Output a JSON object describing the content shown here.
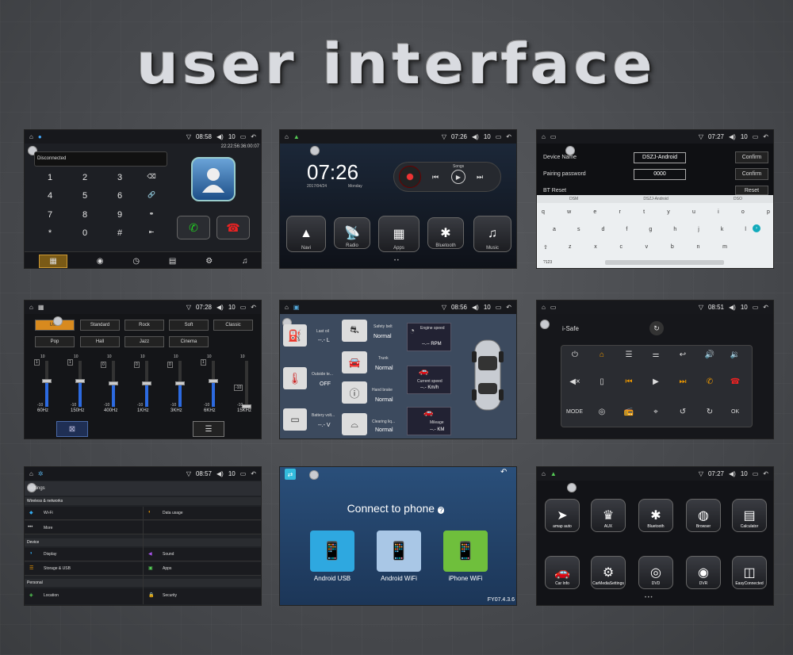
{
  "title": "user interface",
  "s1": {
    "time": "08:58",
    "vol": "10",
    "datetime": "22:22:56:36:00:07",
    "status": "Disconnected",
    "keys": [
      "1",
      "2",
      "3",
      "⌫",
      "4",
      "5",
      "6",
      "🔗",
      "7",
      "8",
      "9",
      "⚭",
      "*",
      "0",
      "#",
      "⇤"
    ]
  },
  "s2": {
    "time": "07:26",
    "vol": "10",
    "clock": "07:26",
    "date": "2017/04/24",
    "day": "Monday",
    "songs": "Songs",
    "apps": [
      {
        "label": "Navi",
        "icon": "▲"
      },
      {
        "label": "Radio",
        "icon": "📡"
      },
      {
        "label": "Apps",
        "icon": "▦"
      },
      {
        "label": "Bluetooth",
        "icon": "✱"
      },
      {
        "label": "Music",
        "icon": "♫"
      }
    ]
  },
  "s3": {
    "time": "07:27",
    "vol": "10",
    "device_name_label": "Device Name",
    "device_name": "DSZJ-Android",
    "pairing_label": "Pairing password",
    "pairing": "0000",
    "reset_label": "BT Reset",
    "confirm": "Confirm",
    "reset": "Reset",
    "suggest": [
      "DSM",
      "DSZJ-Android",
      "DSO"
    ],
    "kb_row1": [
      "q",
      "w",
      "e",
      "r",
      "t",
      "y",
      "u",
      "i",
      "o",
      "p"
    ],
    "kb_row2": [
      "a",
      "s",
      "d",
      "f",
      "g",
      "h",
      "j",
      "k",
      "l"
    ],
    "kb_row3": [
      "z",
      "x",
      "c",
      "v",
      "b",
      "n",
      "m"
    ],
    "kb_sym": "?123"
  },
  "s4": {
    "time": "07:28",
    "vol": "10",
    "presets": [
      "User",
      "Standard",
      "Rock",
      "Soft",
      "Classic",
      "Pop",
      "Hall",
      "Jazz",
      "Cinema"
    ],
    "scale_top": "10",
    "scale_bot": "-10",
    "bands": [
      {
        "freq": "60Hz",
        "val": "1"
      },
      {
        "freq": "150Hz",
        "val": "1"
      },
      {
        "freq": "400Hz",
        "val": "0"
      },
      {
        "freq": "1KHz",
        "val": "0"
      },
      {
        "freq": "3KHz",
        "val": "0"
      },
      {
        "freq": "6KHz",
        "val": "1"
      },
      {
        "freq": "15KHz",
        "val": "-10"
      }
    ],
    "levels": [
      0.55,
      0.55,
      0.5,
      0.5,
      0.5,
      0.55,
      0.0
    ]
  },
  "s5": {
    "time": "08:56",
    "vol": "10",
    "items": [
      {
        "label": "Last oil",
        "value": "--.- L"
      },
      {
        "label": "Outside te...",
        "value": "OFF"
      },
      {
        "label": "Battery volt...",
        "value": "--.- V"
      }
    ],
    "items2": [
      {
        "label": "Safety belt",
        "value": "Normal"
      },
      {
        "label": "Trunk",
        "value": "Normal"
      },
      {
        "label": "Hand brake",
        "value": "Normal"
      },
      {
        "label": "Clearing liq...",
        "value": "Normal"
      }
    ],
    "gauges": [
      {
        "label": "Engine speed",
        "value": "--.-- RPM"
      },
      {
        "label": "Current speed",
        "value": "--.- Km/h"
      },
      {
        "label": "Mileage",
        "value": "--.- KM"
      }
    ]
  },
  "s6": {
    "time": "08:51",
    "vol": "10",
    "title": "i-Safe",
    "mode": "MODE",
    "ok": "OK"
  },
  "s7": {
    "time": "08:57",
    "vol": "10",
    "header": "Settings",
    "sec1": "Wireless & networks",
    "wifi": "Wi-Fi",
    "data": "Data usage",
    "more": "More",
    "sec2": "Device",
    "display": "Display",
    "sound": "Sound",
    "storage": "Storage & USB",
    "apps": "Apps",
    "sec3": "Personal",
    "location": "Location",
    "security": "Security"
  },
  "s8": {
    "title": "Connect to phone",
    "opts": [
      "Android USB",
      "Android WiFi",
      "iPhone WiFi"
    ],
    "version": "FY07.4.3.6"
  },
  "s9": {
    "time": "07:27",
    "vol": "10",
    "apps": [
      {
        "label": "amap auto",
        "icon": "➤"
      },
      {
        "label": "AUX",
        "icon": "♛"
      },
      {
        "label": "Bluetooth",
        "icon": "✱"
      },
      {
        "label": "Browser",
        "icon": "◍"
      },
      {
        "label": "Calculator",
        "icon": "▤"
      },
      {
        "label": "Car Info",
        "icon": "🚗"
      },
      {
        "label": "CarMediaSettings",
        "icon": "⚙"
      },
      {
        "label": "DVD",
        "icon": "◎"
      },
      {
        "label": "DVR",
        "icon": "◉"
      },
      {
        "label": "EasyConnected",
        "icon": "◫"
      }
    ]
  }
}
